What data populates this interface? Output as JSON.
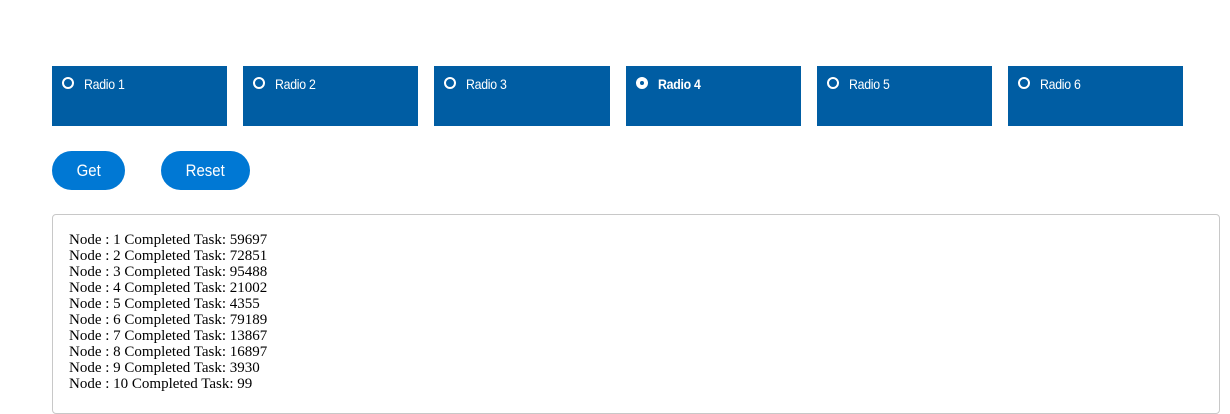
{
  "radios": [
    {
      "label": "Radio 1",
      "selected": false
    },
    {
      "label": "Radio 2",
      "selected": false
    },
    {
      "label": "Radio 3",
      "selected": false
    },
    {
      "label": "Radio 4",
      "selected": true
    },
    {
      "label": "Radio 5",
      "selected": false
    },
    {
      "label": "Radio 6",
      "selected": false
    }
  ],
  "buttons": {
    "get_label": "Get",
    "reset_label": "Reset"
  },
  "output": {
    "lines": [
      "Node : 1 Completed Task: 59697",
      "Node : 2 Completed Task: 72851",
      "Node : 3 Completed Task: 95488",
      "Node : 4 Completed Task: 21002",
      "Node : 5 Completed Task: 4355",
      "Node : 6 Completed Task: 79189",
      "Node : 7 Completed Task: 13867",
      "Node : 8 Completed Task: 16897",
      "Node : 9 Completed Task: 3930",
      "Node : 10 Completed Task: 99"
    ]
  },
  "colors": {
    "radio_background": "#005da3",
    "button_background": "#0078d4"
  }
}
